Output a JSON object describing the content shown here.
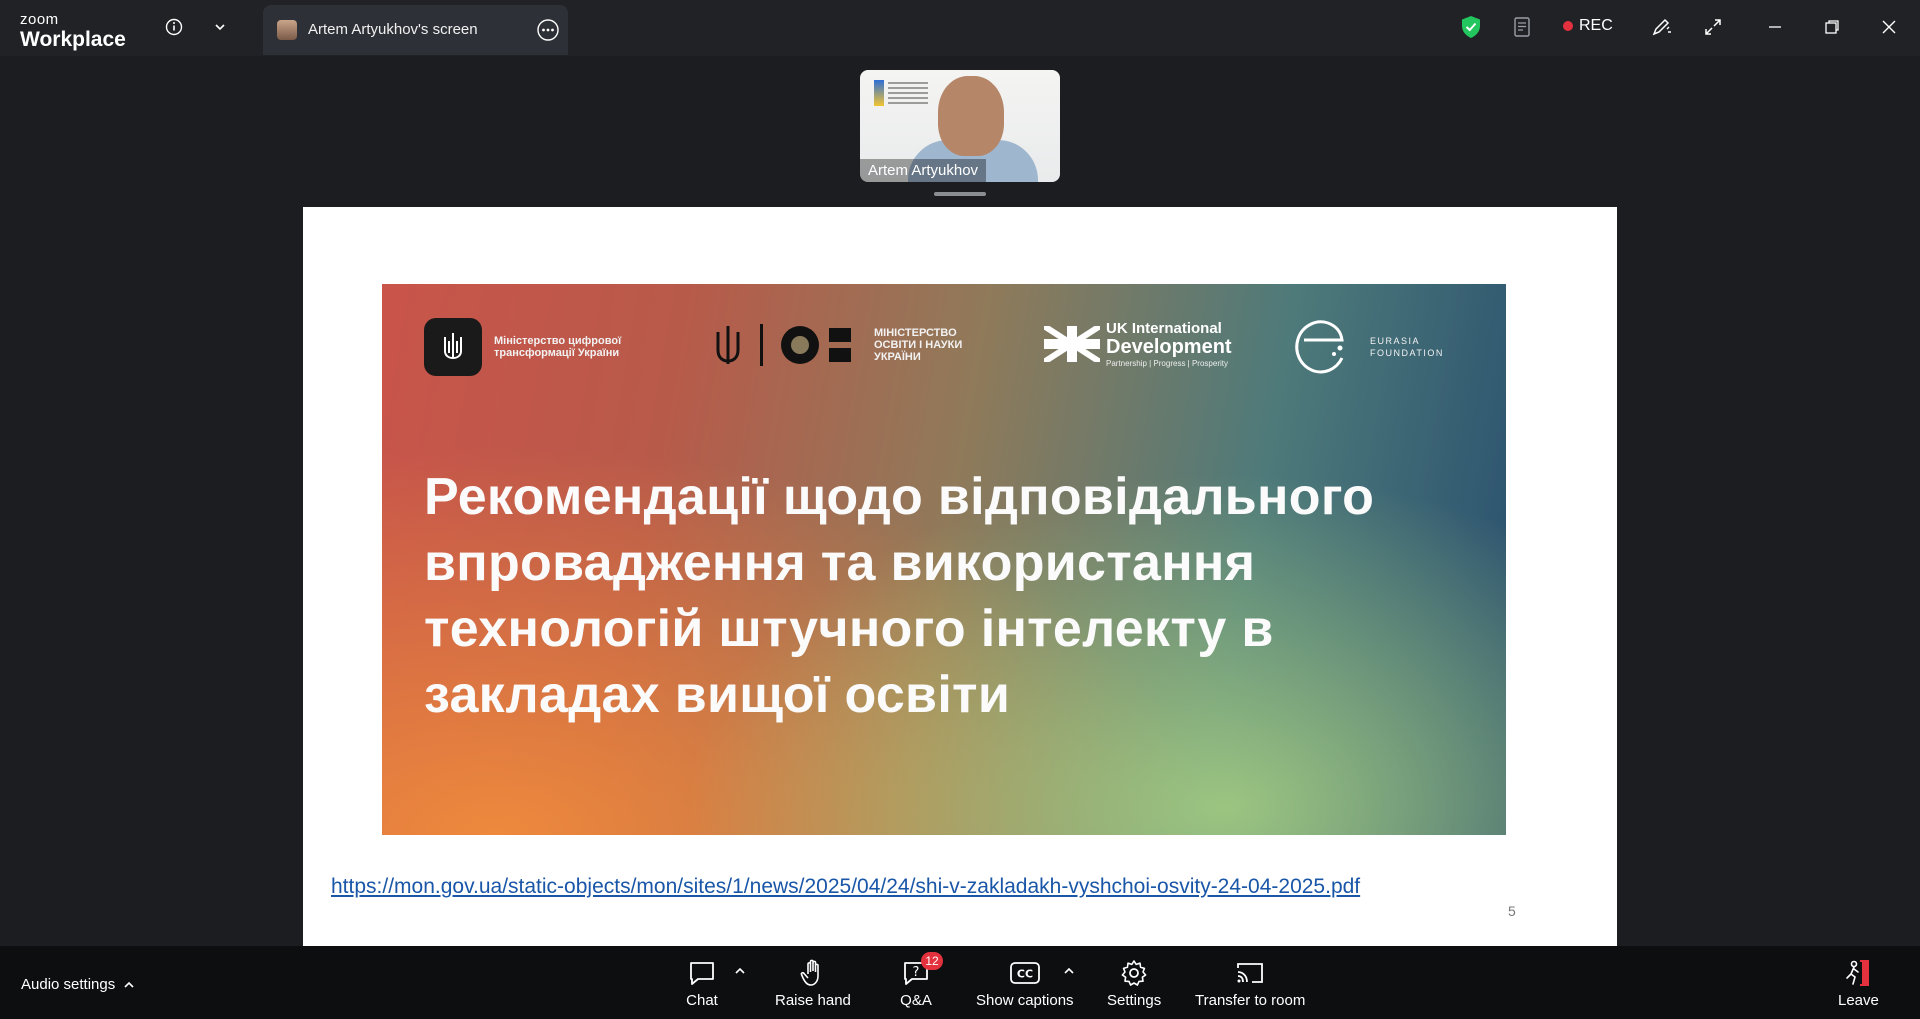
{
  "app": {
    "brand_small": "zoom",
    "brand_large": "Workplace"
  },
  "tab": {
    "title": "Artem Artyukhov's screen"
  },
  "titlebar": {
    "rec_label": "REC"
  },
  "video": {
    "participant_name": "Artem Artyukhov"
  },
  "slide": {
    "logos": {
      "digital_ministry": "Міністерство цифрової трансформації України",
      "mon": "МІНІСТЕРСТВО ОСВІТИ І НАУКИ УКРАЇНИ",
      "uk_line1": "UK International",
      "uk_line2": "Development",
      "uk_sub": "Partnership  |  Progress  |  Prosperity",
      "eurasia": "EURASIA FOUNDATION"
    },
    "title": "Рекомендації щодо відповідального впровадження та використання технологій штучного інтелекту в закладах вищої освіти",
    "link": "https://mon.gov.ua/static-objects/mon/sites/1/news/2025/04/24/shi-v-zakladakh-vyshchoi-osvity-24-04-2025.pdf",
    "page_number": "5"
  },
  "toolbar": {
    "audio_settings": "Audio settings",
    "chat": "Chat",
    "raise_hand": "Raise hand",
    "qa": "Q&A",
    "qa_badge": "12",
    "show_captions": "Show captions",
    "settings": "Settings",
    "transfer": "Transfer to room",
    "leave": "Leave"
  },
  "colors": {
    "shield": "#22c55e",
    "rec_dot": "#e5303d",
    "leave": "#e3323e",
    "link": "#1a56a8"
  }
}
